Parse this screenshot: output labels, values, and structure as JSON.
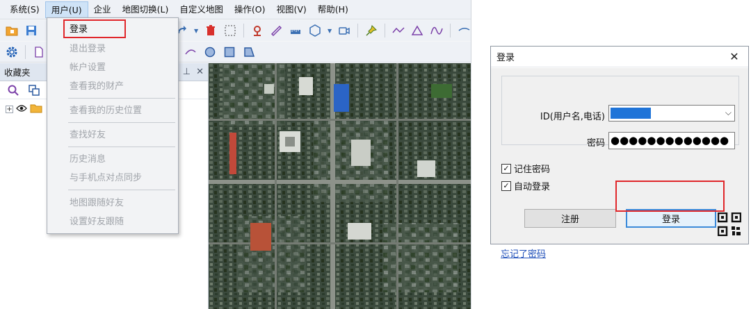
{
  "menubar": {
    "items": [
      "系统(S)",
      "用户(U)",
      "企业",
      "地图切换(L)",
      "自定义地图",
      "操作(O)",
      "视图(V)",
      "帮助(H)"
    ]
  },
  "user_menu": {
    "items": [
      {
        "label": "登录",
        "enabled": true
      },
      {
        "label": "退出登录",
        "enabled": false
      },
      {
        "label": "帐户设置",
        "enabled": false
      },
      {
        "label": "查看我的财产",
        "enabled": false
      },
      {
        "label": "查看我的历史位置",
        "enabled": false
      },
      {
        "label": "查找好友",
        "enabled": false
      },
      {
        "label": "历史消息",
        "enabled": false
      },
      {
        "label": "与手机点对点同步",
        "enabled": false
      },
      {
        "label": "地图跟随好友",
        "enabled": false
      },
      {
        "label": "设置好友跟随",
        "enabled": false
      }
    ]
  },
  "favorites": {
    "title": "收藏夹",
    "pin_icon": "pin-icon",
    "close_icon": "close-icon"
  },
  "login_dialog": {
    "title": "登录",
    "id_label": "ID(用户名,电话)",
    "id_value": "",
    "password_label": "密码",
    "password_value": "●●●●●●●●●●●●●",
    "remember_label": "记住密码",
    "remember_checked": true,
    "auto_login_label": "自动登录",
    "auto_login_checked": true,
    "register_label": "注册",
    "login_label": "登录",
    "forgot_label": "忘记了密码",
    "qr_icon": "qr-code-icon"
  },
  "colors": {
    "highlight_red": "#e0262a",
    "selection_blue": "#1f74d8",
    "link_blue": "#1f4fb9"
  }
}
